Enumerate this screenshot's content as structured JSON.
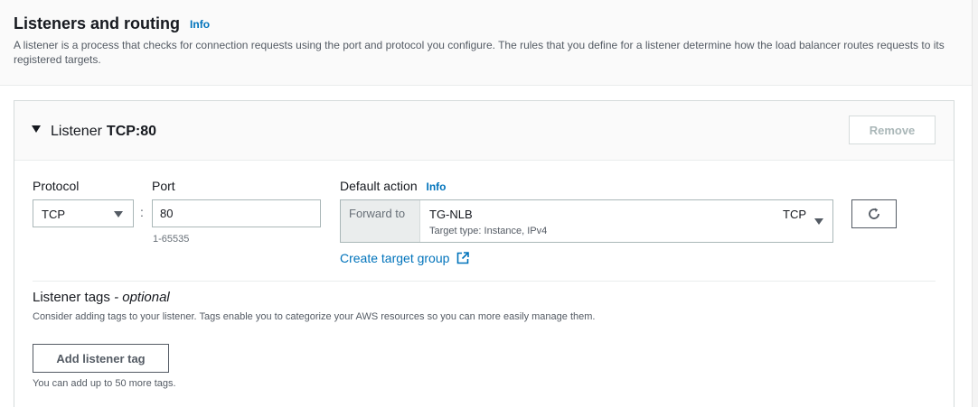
{
  "section": {
    "title": "Listeners and routing",
    "info": "Info",
    "description": "A listener is a process that checks for connection requests using the port and protocol you configure. The rules that you define for a listener determine how the load balancer routes requests to its registered targets."
  },
  "listener": {
    "heading_prefix": "Listener",
    "heading_value": "TCP:80",
    "remove_label": "Remove",
    "protocol_label": "Protocol",
    "protocol_value": "TCP",
    "port_label": "Port",
    "port_value": "80",
    "port_hint": "1-65535",
    "default_action_label": "Default action",
    "default_action_info": "Info",
    "forward_to": "Forward to",
    "target_group_name": "TG-NLB",
    "target_group_type": "Target type: Instance, IPv4",
    "target_group_protocol": "TCP",
    "create_target_group": "Create target group"
  },
  "tags": {
    "title": "Listener tags",
    "optional": "- optional",
    "description": "Consider adding tags to your listener. Tags enable you to categorize your AWS resources so you can more easily manage them.",
    "add_button": "Add listener tag",
    "hint": "You can add up to 50 more tags."
  },
  "colors": {
    "link": "#0073bb",
    "text": "#16191f",
    "muted": "#545b64"
  }
}
